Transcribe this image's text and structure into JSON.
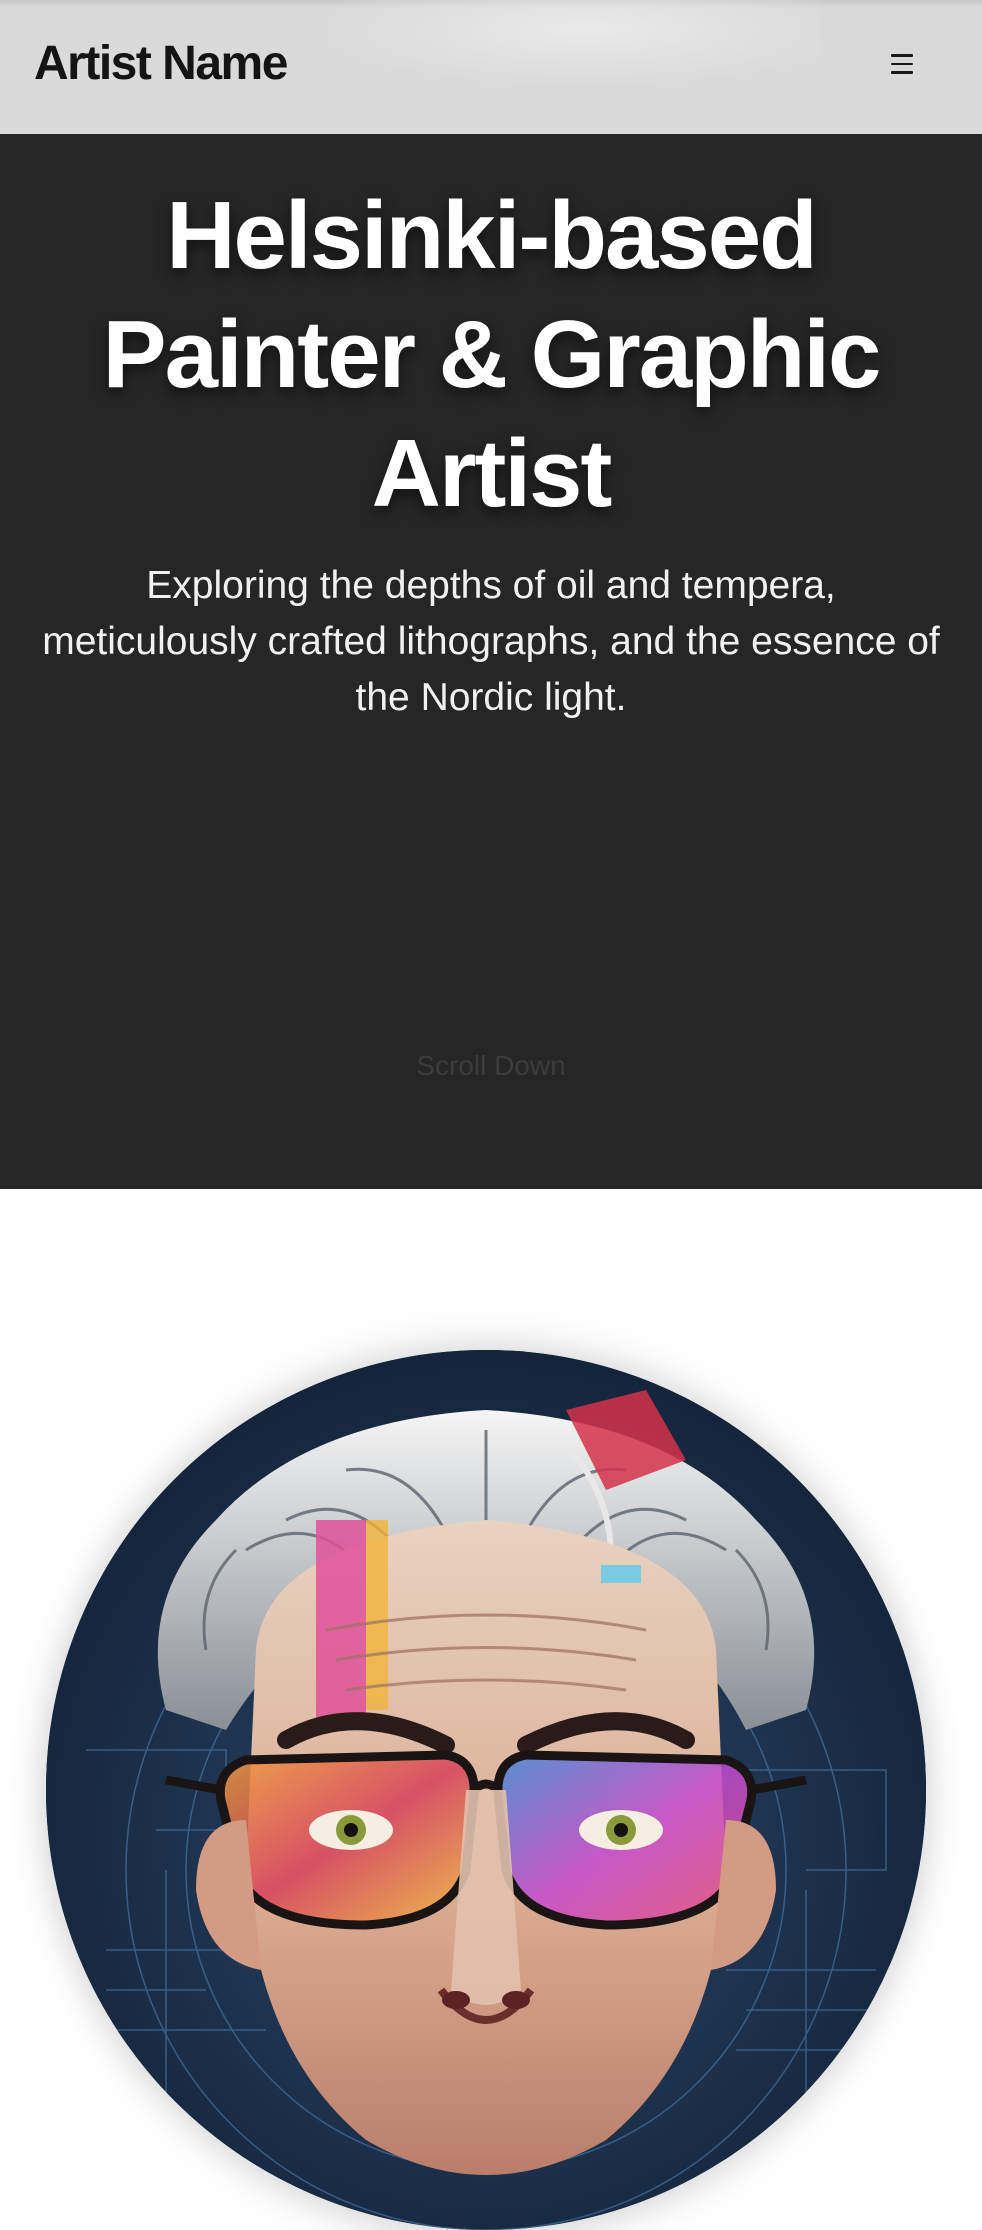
{
  "header": {
    "brand": "Artist Name",
    "menu_icon": "hamburger-menu-icon"
  },
  "hero": {
    "title": "Helsinki-based Painter & Graphic Artist",
    "subtitle": "Exploring the depths of oil and tempera, meticulously crafted lithographs, and the essence of the Nordic light.",
    "scroll_label": "Scroll Down"
  },
  "colors": {
    "hero_background": "#262626",
    "header_background": "#d9d9d9",
    "brand_text": "#141414"
  }
}
